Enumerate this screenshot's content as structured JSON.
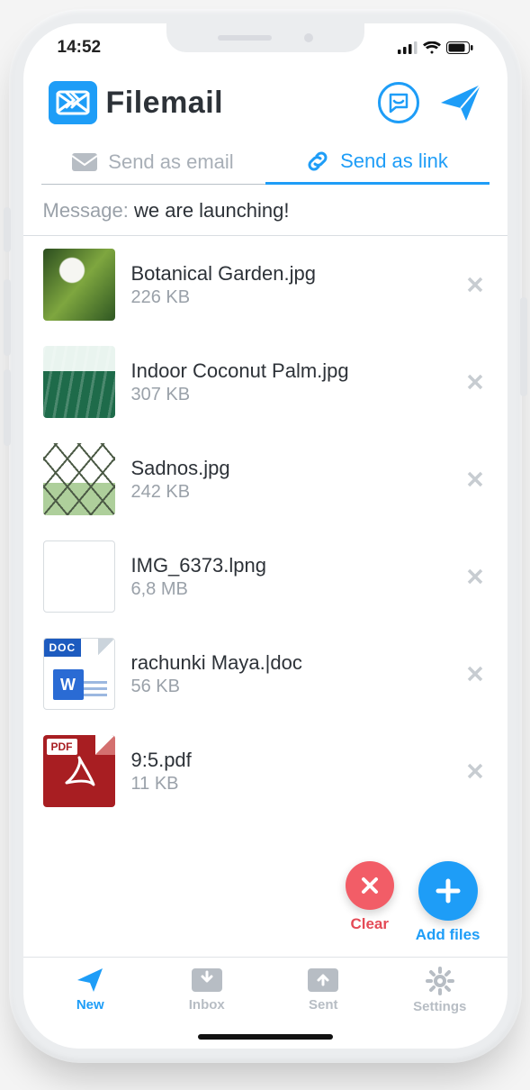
{
  "status": {
    "time": "14:52"
  },
  "brand": {
    "name": "Filemail"
  },
  "tabs": {
    "email": "Send as email",
    "link": "Send as link"
  },
  "message": {
    "label": "Message:",
    "value": "we are launching!"
  },
  "files": [
    {
      "name": "Botanical Garden.jpg",
      "size": "226 KB"
    },
    {
      "name": "Indoor Coconut Palm.jpg",
      "size": "307 KB"
    },
    {
      "name": "Sadnos.jpg",
      "size": "242 KB"
    },
    {
      "name": "IMG_6373.lpng",
      "size": "6,8 MB"
    },
    {
      "name": "rachunki Maya.|doc",
      "size": "56 KB"
    },
    {
      "name": "9:5.pdf",
      "size": "11 KB"
    }
  ],
  "fabs": {
    "clear": "Clear",
    "add": "Add files"
  },
  "tabbar": {
    "new": "New",
    "inbox": "Inbox",
    "sent": "Sent",
    "settings": "Settings"
  },
  "doc_badge": "DOC",
  "pdf_badge": "PDF"
}
